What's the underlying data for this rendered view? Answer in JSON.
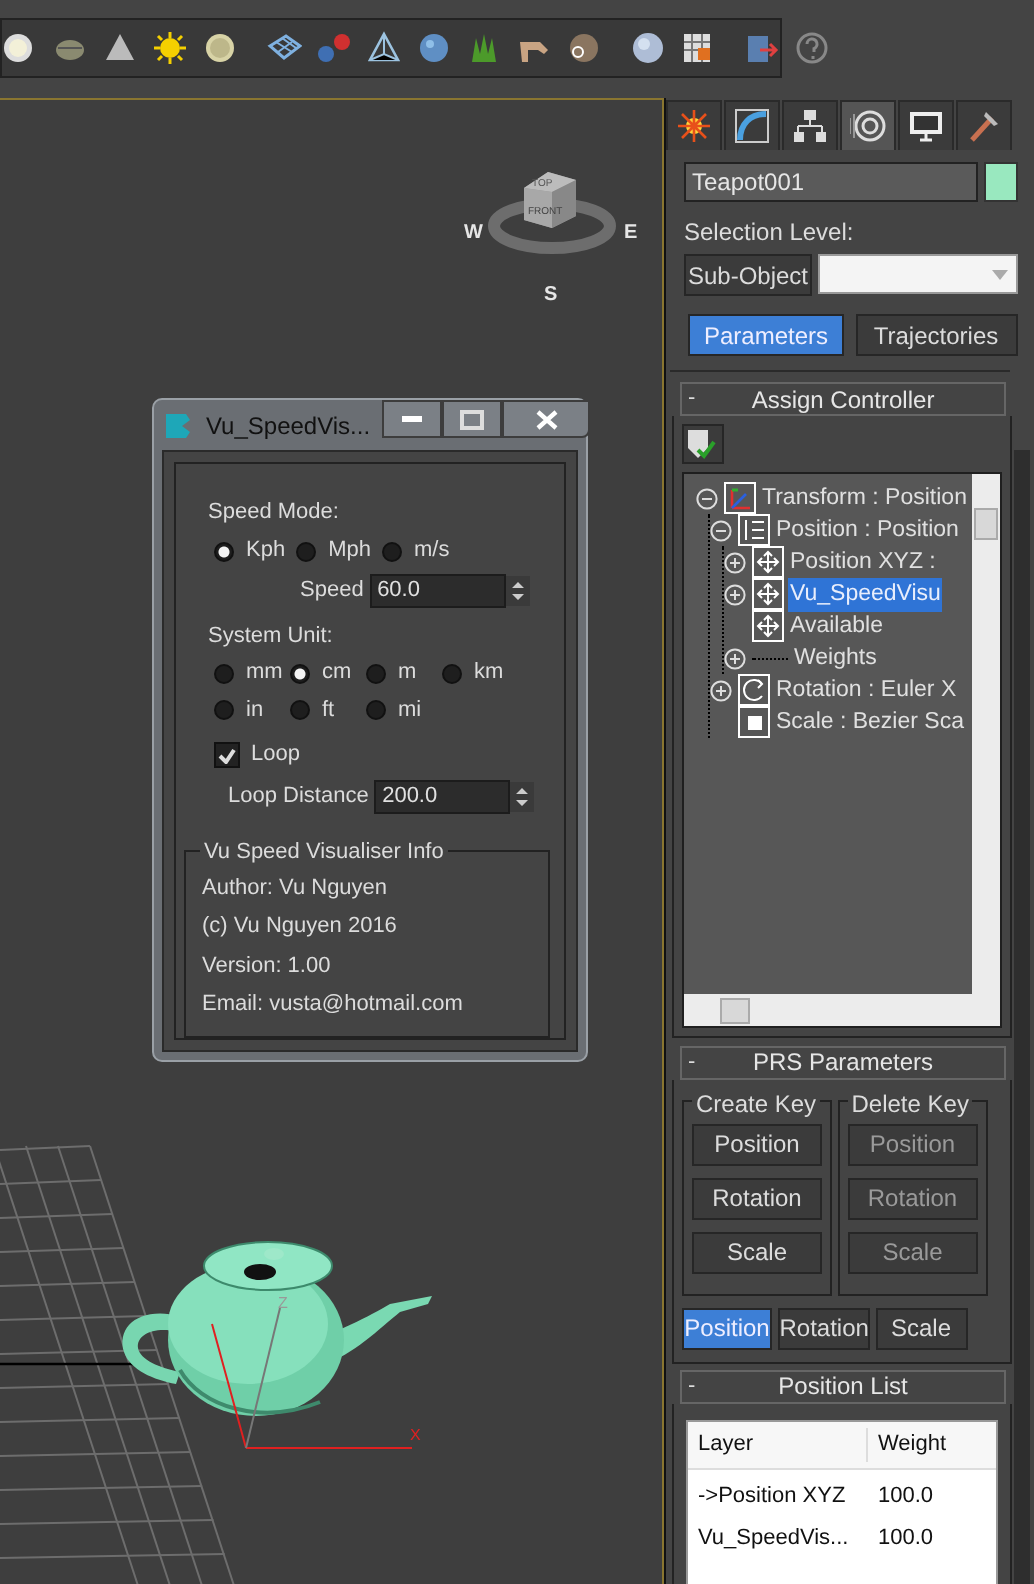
{
  "viewport": {
    "viewcube": {
      "faces": [
        "TOP",
        "FRONT"
      ],
      "compass": [
        "W",
        "E",
        "S"
      ]
    },
    "gizmo_labels": [
      "Z",
      "X"
    ]
  },
  "dialog": {
    "title": "Vu_SpeedVis...",
    "speed_mode": {
      "label": "Speed Mode:",
      "options": [
        {
          "label": "Kph",
          "selected": true
        },
        {
          "label": "Mph",
          "selected": false
        },
        {
          "label": "m/s",
          "selected": false
        }
      ]
    },
    "speed": {
      "label": "Speed",
      "value": "60.0"
    },
    "system_unit": {
      "label": "System Unit:",
      "options": [
        {
          "label": "mm",
          "selected": false
        },
        {
          "label": "cm",
          "selected": true
        },
        {
          "label": "m",
          "selected": false
        },
        {
          "label": "km",
          "selected": false
        },
        {
          "label": "in",
          "selected": false
        },
        {
          "label": "ft",
          "selected": false
        },
        {
          "label": "mi",
          "selected": false
        }
      ]
    },
    "loop": {
      "label": "Loop",
      "checked": true
    },
    "loop_distance": {
      "label": "Loop Distance",
      "value": "200.0"
    },
    "info": {
      "title": "Vu Speed Visualiser Info",
      "lines": [
        "Author: Vu Nguyen",
        "(c) Vu Nguyen 2016",
        "Version: 1.00",
        "Email: vusta@hotmail.com"
      ]
    }
  },
  "command_panel": {
    "tabs": [
      {
        "selected": false
      },
      {
        "selected": false
      },
      {
        "selected": false
      },
      {
        "selected": true
      },
      {
        "selected": false
      },
      {
        "selected": false
      }
    ],
    "object": {
      "name": "Teapot001",
      "color": "#99e8bf"
    },
    "selection_level": {
      "label": "Selection Level:",
      "button": "Sub-Object"
    },
    "mode_buttons": [
      {
        "label": "Parameters",
        "selected": true
      },
      {
        "label": "Trajectories",
        "selected": false
      }
    ],
    "assign_controller": {
      "title": "Assign Controller",
      "collapse": "-",
      "tree": [
        {
          "label": "Transform : Position",
          "kind": "transform",
          "expanded": true,
          "selected": false,
          "children": [
            {
              "label": "Position : Position",
              "kind": "list",
              "expanded": true,
              "selected": false,
              "children": [
                {
                  "label": "Position XYZ :",
                  "kind": "position",
                  "expanded": false,
                  "selected": false
                },
                {
                  "label": "Vu_SpeedVisu",
                  "kind": "position",
                  "expanded": false,
                  "selected": true
                },
                {
                  "label": "Available",
                  "kind": "position",
                  "selected": false
                },
                {
                  "label": "Weights",
                  "kind": "none",
                  "expanded": false,
                  "selected": false
                }
              ]
            },
            {
              "label": "Rotation : Euler X",
              "kind": "rotation",
              "expanded": false,
              "selected": false
            },
            {
              "label": "Scale : Bezier Sca",
              "kind": "scale",
              "selected": false
            }
          ]
        }
      ]
    },
    "prs": {
      "title": "PRS Parameters",
      "collapse": "-",
      "groups": [
        {
          "title": "Create Key",
          "disabled": false,
          "buttons": [
            "Position",
            "Rotation",
            "Scale"
          ]
        },
        {
          "title": "Delete Key",
          "disabled": true,
          "buttons": [
            "Position",
            "Rotation",
            "Scale"
          ]
        }
      ],
      "mode_buttons": [
        {
          "label": "Position",
          "selected": true
        },
        {
          "label": "Rotation",
          "selected": false
        },
        {
          "label": "Scale",
          "selected": false
        }
      ]
    },
    "position_list": {
      "title": "Position List",
      "collapse": "-",
      "columns": [
        "Layer",
        "Weight"
      ],
      "rows": [
        [
          "->Position XYZ",
          "100.0"
        ],
        [
          "Vu_SpeedVis...",
          "100.0"
        ]
      ]
    }
  }
}
